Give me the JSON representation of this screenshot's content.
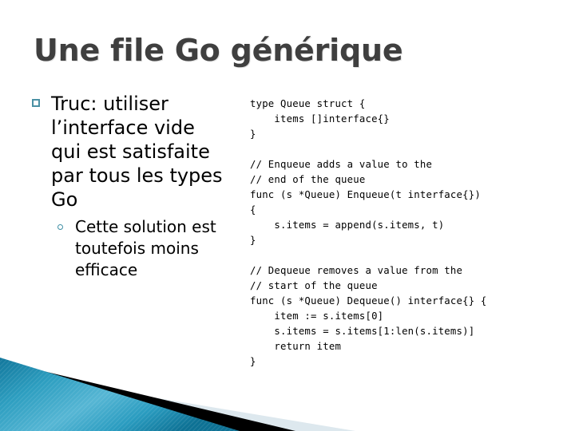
{
  "slide": {
    "title": "Une file Go générique",
    "title_color": "#3f3f3f",
    "background": "#ffffff"
  },
  "bullets": {
    "level1_marker": "hollow-square",
    "level1_marker_color": "#4a90a4",
    "level2_marker": "hollow-circle",
    "level2_marker_color": "#3f8fa5",
    "items": [
      {
        "level": 1,
        "text": "Truc: utiliser l’interface vide qui est satisfaite par tous les types Go"
      },
      {
        "level": 2,
        "text": "Cette solution est toutefois moins efficace"
      }
    ]
  },
  "code": {
    "language": "go",
    "blocks": [
      "type Queue struct {\n    items []interface{}\n}",
      "// Enqueue adds a value to the\n// end of the queue\nfunc (s *Queue) Enqueue(t interface{})\n{\n    s.items = append(s.items, t)\n}",
      "// Dequeue removes a value from the\n// start of the queue\nfunc (s *Queue) Dequeue() interface{} {\n    item := s.items[0]\n    s.items = s.items[1:len(s.items)]\n    return item\n}"
    ]
  },
  "decoration": {
    "name": "bottom-left-diagonal-bands",
    "teal_light": "#4fb0d0",
    "teal_dark": "#0f7ba3",
    "black": "#000000",
    "pale_blue": "#dde8ee"
  }
}
